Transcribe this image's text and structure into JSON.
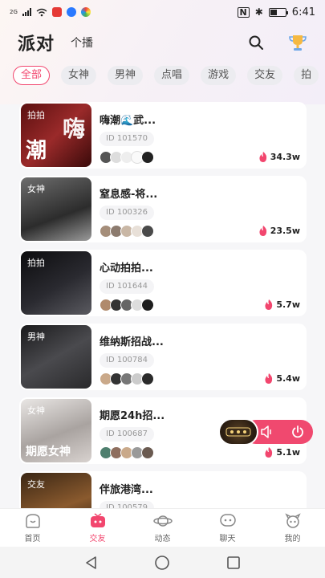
{
  "status_bar": {
    "network": "2G",
    "time": "6:41"
  },
  "header": {
    "title": "派对",
    "subtab": "个播"
  },
  "filters": [
    "全部",
    "女神",
    "男神",
    "点唱",
    "游戏",
    "交友",
    "拍"
  ],
  "active_filter_index": 0,
  "rooms": [
    {
      "name": "嗨潮🌊武...",
      "id": "ID  101570",
      "tag": "拍拍",
      "art": "嗨",
      "art2": "潮",
      "heat": "34.3w",
      "thumb_color": "#7a1f1f"
    },
    {
      "name": "窒息感-将...",
      "id": "ID  100326",
      "tag": "女神",
      "art": "",
      "art2": "",
      "heat": "23.5w",
      "thumb_color": "#3a3a3a"
    },
    {
      "name": "心动拍拍...",
      "id": "ID  101644",
      "tag": "拍拍",
      "art": "",
      "art2": "",
      "heat": "5.7w",
      "thumb_color": "#1c1c1e"
    },
    {
      "name": "维纳斯招战...",
      "id": "ID  100784",
      "tag": "男神",
      "art": "",
      "art2": "",
      "heat": "5.4w",
      "thumb_color": "#2e2e30"
    },
    {
      "name": "期愿24h招...",
      "id": "ID  100687",
      "tag": "女神",
      "art": "",
      "art2": "期愿女神",
      "heat": "5.1w",
      "thumb_color": "#c9c4c4"
    },
    {
      "name": "伴旅港湾...",
      "id": "ID  100579",
      "tag": "交友",
      "art": "",
      "art2": "",
      "heat": "",
      "thumb_color": "#6b4a2a"
    }
  ],
  "tabbar": [
    {
      "label": "首页",
      "icon": "home-icon"
    },
    {
      "label": "交友",
      "icon": "tv-icon"
    },
    {
      "label": "动态",
      "icon": "planet-icon"
    },
    {
      "label": "聊天",
      "icon": "chat-icon"
    },
    {
      "label": "我的",
      "icon": "profile-icon"
    }
  ],
  "active_tab_index": 1,
  "accent_color": "#f2466e"
}
